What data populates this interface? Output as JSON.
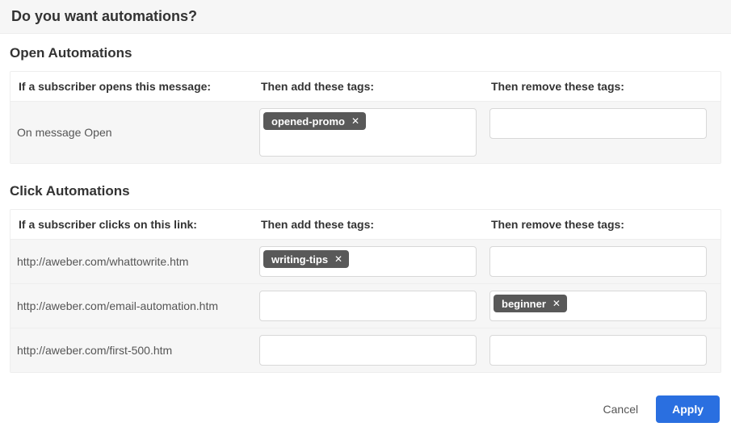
{
  "header": {
    "title": "Do you want automations?"
  },
  "open_section": {
    "title": "Open Automations",
    "col1_header": "If a subscriber opens this message:",
    "col2_header": "Then add these tags:",
    "col3_header": "Then remove these tags:",
    "rows": [
      {
        "trigger": "On message Open",
        "add_tags": [
          "opened-promo"
        ],
        "remove_tags": []
      }
    ]
  },
  "click_section": {
    "title": "Click Automations",
    "col1_header": "If a subscriber clicks on this link:",
    "col2_header": "Then add these tags:",
    "col3_header": "Then remove these tags:",
    "rows": [
      {
        "link": "http://aweber.com/whattowrite.htm",
        "add_tags": [
          "writing-tips"
        ],
        "remove_tags": []
      },
      {
        "link": "http://aweber.com/email-automation.htm",
        "add_tags": [],
        "remove_tags": [
          "beginner"
        ]
      },
      {
        "link": "http://aweber.com/first-500.htm",
        "add_tags": [],
        "remove_tags": []
      }
    ]
  },
  "footer": {
    "cancel_label": "Cancel",
    "apply_label": "Apply"
  }
}
